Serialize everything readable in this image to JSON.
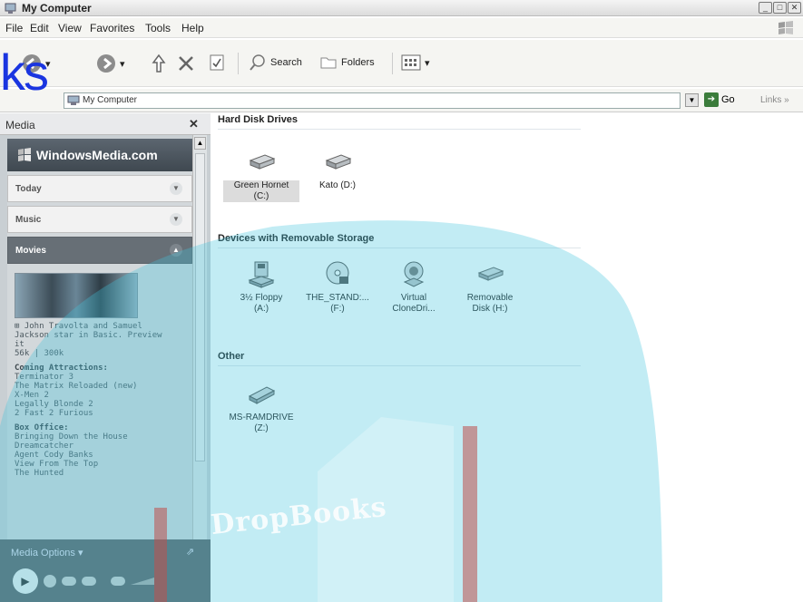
{
  "window": {
    "title": "My Computer"
  },
  "menu": [
    "File",
    "Edit",
    "View",
    "Favorites",
    "Tools",
    "Help"
  ],
  "toolbar": {
    "search_label": "Search",
    "folders_label": "Folders"
  },
  "address": {
    "value": "My Computer",
    "go_label": "Go",
    "links_label": "Links"
  },
  "media": {
    "pane_label": "Media",
    "brand": "WindowsMedia.com",
    "sections": {
      "today": "Today",
      "music": "Music",
      "movies": "Movies"
    },
    "thumb_caption": [
      "⊞ John Travolta and Samuel",
      "Jackson star in Basic. Preview",
      "it",
      "56k | 300k"
    ],
    "coming_title": "Coming Attractions:",
    "coming": [
      "Terminator 3",
      "The Matrix Reloaded (new)",
      "X-Men 2",
      "Legally Blonde 2",
      "2 Fast 2 Furious"
    ],
    "box_title": "Box Office:",
    "box": [
      "Bringing Down the House",
      "Dreamcatcher",
      "Agent Cody Banks",
      "View From The Top",
      "The Hunted"
    ],
    "options_label": "Media Options ▾"
  },
  "groups": {
    "hdd": {
      "title": "Hard Disk Drives",
      "items": [
        {
          "l1": "Green Hornet",
          "l2": "(C:)"
        },
        {
          "l1": "Kato (D:)",
          "l2": ""
        }
      ]
    },
    "removable": {
      "title": "Devices with Removable Storage",
      "items": [
        {
          "l1": "3½ Floppy",
          "l2": "(A:)"
        },
        {
          "l1": "THE_STAND:...",
          "l2": "(F:)"
        },
        {
          "l1": "Virtual",
          "l2": "CloneDri..."
        },
        {
          "l1": "Removable",
          "l2": "Disk (H:)"
        }
      ]
    },
    "other": {
      "title": "Other",
      "items": [
        {
          "l1": "MS-RAMDRIVE",
          "l2": "(Z:)"
        }
      ]
    }
  },
  "overlay": {
    "ks": "ks",
    "dropbooks": "DropBooks"
  },
  "colors": {
    "overlay_cyan": "#40c4dc",
    "overlay_blue": "#1a35e0",
    "book_red": "#c0504d"
  }
}
